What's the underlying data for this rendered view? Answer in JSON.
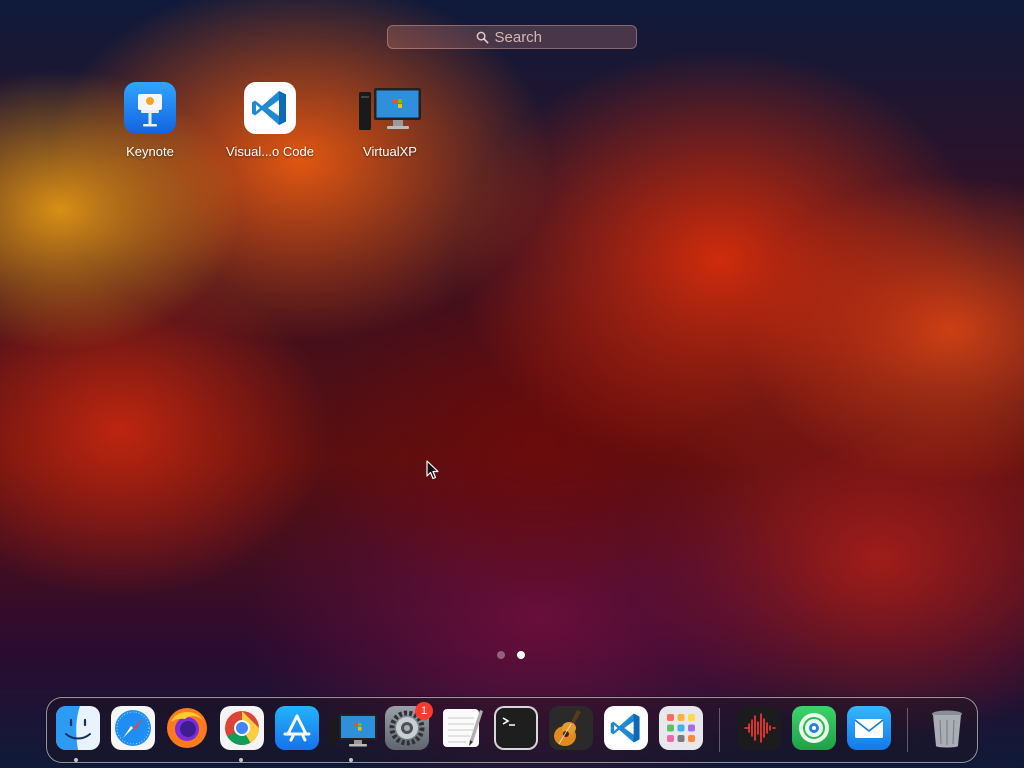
{
  "search": {
    "placeholder": "Search"
  },
  "apps": [
    {
      "label": "Keynote",
      "icon": "keynote-icon"
    },
    {
      "label": "Visual...o Code",
      "icon": "vscode-icon"
    },
    {
      "label": "VirtualXP",
      "icon": "virtualxp-icon"
    }
  ],
  "pages": {
    "count": 2,
    "current": 2
  },
  "dock": {
    "items": [
      {
        "name": "finder-icon",
        "running": true
      },
      {
        "name": "safari-icon",
        "running": false
      },
      {
        "name": "firefox-icon",
        "running": false
      },
      {
        "name": "chrome-icon",
        "running": true
      },
      {
        "name": "app-store-icon",
        "running": false
      },
      {
        "name": "virtualxp-icon",
        "running": true
      },
      {
        "name": "system-settings-icon",
        "running": false,
        "badge": "1"
      },
      {
        "name": "textedit-icon",
        "running": false
      },
      {
        "name": "terminal-icon",
        "running": false
      },
      {
        "name": "garageband-icon",
        "running": false
      },
      {
        "name": "vscode-icon",
        "running": false
      },
      {
        "name": "launchpad-icon",
        "running": false
      },
      {
        "name": "voice-memos-icon",
        "running": false
      },
      {
        "name": "find-my-icon",
        "running": false
      },
      {
        "name": "mail-icon",
        "running": false
      },
      {
        "name": "trash-icon",
        "running": false
      }
    ]
  },
  "colors": {
    "accent": "#1463e0",
    "badge": "#ff3b30",
    "terminal_bg": "#1e1e1e"
  }
}
